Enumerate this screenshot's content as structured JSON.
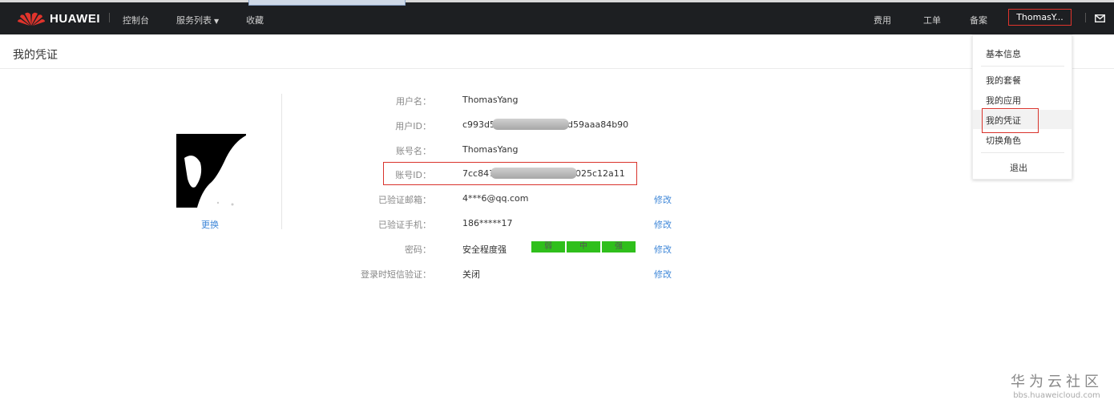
{
  "header": {
    "brand": "HUAWEI",
    "nav": [
      "控制台",
      "服务列表",
      "收藏"
    ],
    "right_nav": [
      "费用",
      "工单",
      "备案"
    ],
    "user": "ThomasY..."
  },
  "page": {
    "title": "我的凭证"
  },
  "profile": {
    "change_label": "更换"
  },
  "fields": {
    "username_label": "用户名：",
    "username_value": "ThomasYang",
    "userid_label": "用户ID：",
    "userid_prefix": "c993d5",
    "userid_suffix": "d59aaa84b90",
    "account_label": "账号名：",
    "account_value": "ThomasYang",
    "accountid_label": "账号ID：",
    "accountid_prefix": "7cc847",
    "accountid_suffix": "025c12a11",
    "email_label": "已验证邮箱：",
    "email_value": "4***6@qq.com",
    "phone_label": "已验证手机：",
    "phone_value": "186*****17",
    "password_label": "密码：",
    "password_value": "安全程度强",
    "sms_label": "登录时短信验证：",
    "sms_value": "关闭",
    "edit_label": "修改"
  },
  "strength": [
    "弱",
    "中",
    "强"
  ],
  "dropdown": {
    "items": [
      "基本信息",
      "我的套餐",
      "我的应用",
      "我的凭证",
      "切换角色",
      "退出"
    ]
  },
  "watermark": {
    "main": "华为云社区",
    "sub": "bbs.huaweicloud.com"
  },
  "colors": {
    "accent": "#3f87d8",
    "highlight": "#d9332c",
    "strength": "#2fbf1b",
    "topbar": "#1d1f22"
  }
}
